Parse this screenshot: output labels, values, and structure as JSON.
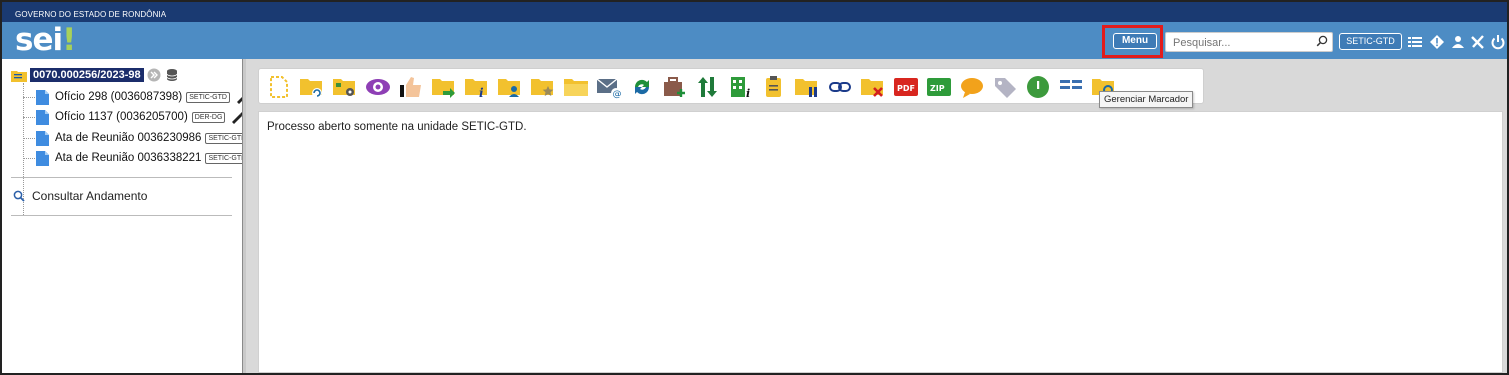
{
  "gov": {
    "title": "GOVERNO DO ESTADO DE RONDÔNIA"
  },
  "header": {
    "logo": "sei",
    "logo_mark": "!",
    "menu_label": "Menu",
    "search_placeholder": "Pesquisar...",
    "unit_label": "SETIC-GTD",
    "icons": [
      "list-icon",
      "alert-icon",
      "user-icon",
      "tools-icon",
      "power-icon"
    ]
  },
  "tree": {
    "process_number": "0070.000256/2023-98",
    "documents": [
      {
        "label": "Ofício 298 (0036087398)",
        "unit": "SETIC-GTD"
      },
      {
        "label": "Ofício 1137 (0036205700)",
        "unit": "DER-DG"
      },
      {
        "label": "Ata de Reunião 0036230986",
        "unit": "SETIC-GTD"
      },
      {
        "label": "Ata de Reunião 0036338221",
        "unit": "SETIC-GTD"
      }
    ],
    "consultar_label": "Consultar Andamento"
  },
  "content": {
    "message": "Processo aberto somente na unidade SETIC-GTD.",
    "tooltip": "Gerenciar Marcador"
  },
  "colors": {
    "gov_strip": "#1a3a72",
    "header": "#4d8cc4",
    "highlight": "#e21b1b",
    "folder": "#f2c12e"
  }
}
